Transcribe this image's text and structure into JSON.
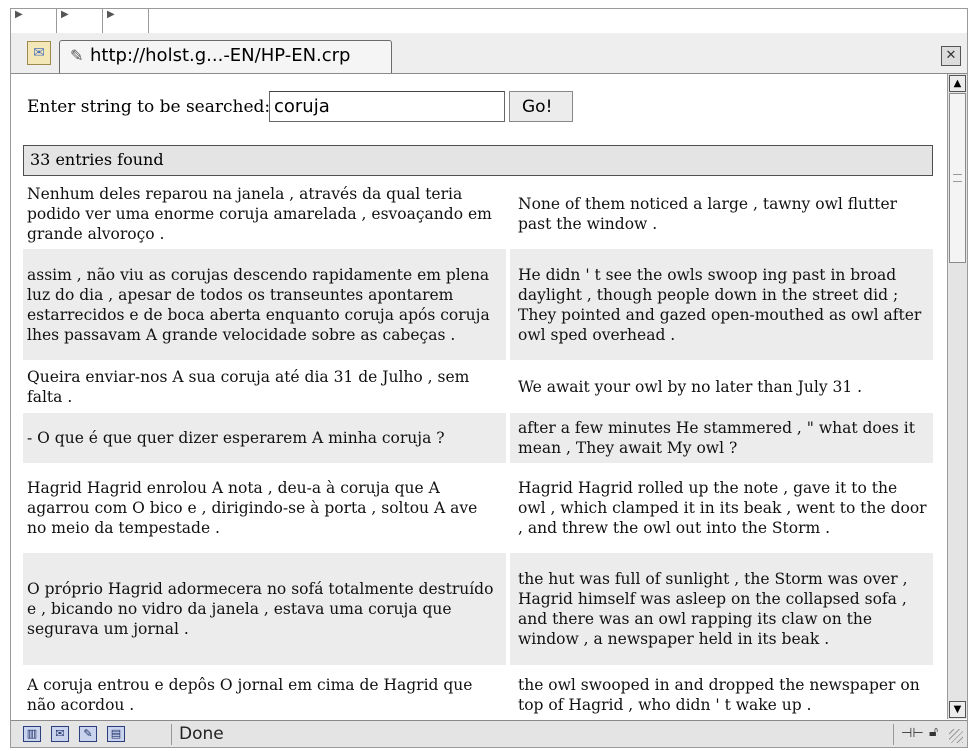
{
  "browser": {
    "tab": {
      "title": "http://holst.g...-EN/HP-EN.crp"
    }
  },
  "search": {
    "label": "Enter string to be searched:",
    "value": "coruja",
    "button_label": "Go!"
  },
  "results": {
    "header": "33 entries found",
    "rows": [
      {
        "pt": "Nenhum deles reparou na janela , através da qual teria podido ver uma enorme coruja amarelada , esvoaçando em grande alvoroço .",
        "en": "None of them noticed a large , tawny owl flutter past the window ."
      },
      {
        "pt": "assim , não viu as corujas descendo rapidamente em plena luz do dia , apesar de todos os transeuntes apontarem estarrecidos e de boca aberta enquanto coruja após coruja lhes passavam A grande velocidade sobre as cabeças .",
        "en": "He didn ' t see the owls swoop ing past in broad daylight , though people down in the street did ; They pointed and gazed open-mouthed as owl after owl sped overhead ."
      },
      {
        "pt": "Queira enviar-nos A sua coruja até dia 31 de Julho , sem falta .",
        "en": "We await your owl by no later than July 31 ."
      },
      {
        "pt": "- O que é que quer dizer esperarem A minha coruja ?",
        "en": "after a few minutes He stammered , \" what does it mean , They await My owl ?"
      },
      {
        "pt": "Hagrid Hagrid enrolou A nota , deu-a à coruja que A agarrou com O bico e , dirigindo-se à porta , soltou A ave no meio da tempestade .",
        "en": "Hagrid Hagrid rolled up the note , gave it to the owl , which clamped it in its beak , went to the door , and threw the owl out into the Storm ."
      },
      {
        "pt": "O próprio Hagrid adormecera no sofá totalmente destruído e , bicando no vidro da janela , estava uma coruja que segurava um jornal .",
        "en": "the hut was full of sunlight , the Storm was over , Hagrid himself was asleep on the collapsed sofa , and there was an owl rapping its claw on the window , a newspaper held in its beak ."
      },
      {
        "pt": "A coruja entrou e depôs O jornal em cima de Hagrid que não acordou .",
        "en": "the owl swooped in and dropped the newspaper on top of Hagrid , who didn ' t wake up ."
      }
    ]
  },
  "status": {
    "text": "Done"
  },
  "icons": {
    "site": "page-icon",
    "tab_pin": "link-icon",
    "close": "close-icon",
    "status": [
      "navigator-icon",
      "mail-icon",
      "composer-icon",
      "addressbook-icon"
    ],
    "connection": "connection-icon",
    "security": "lock-icon"
  }
}
